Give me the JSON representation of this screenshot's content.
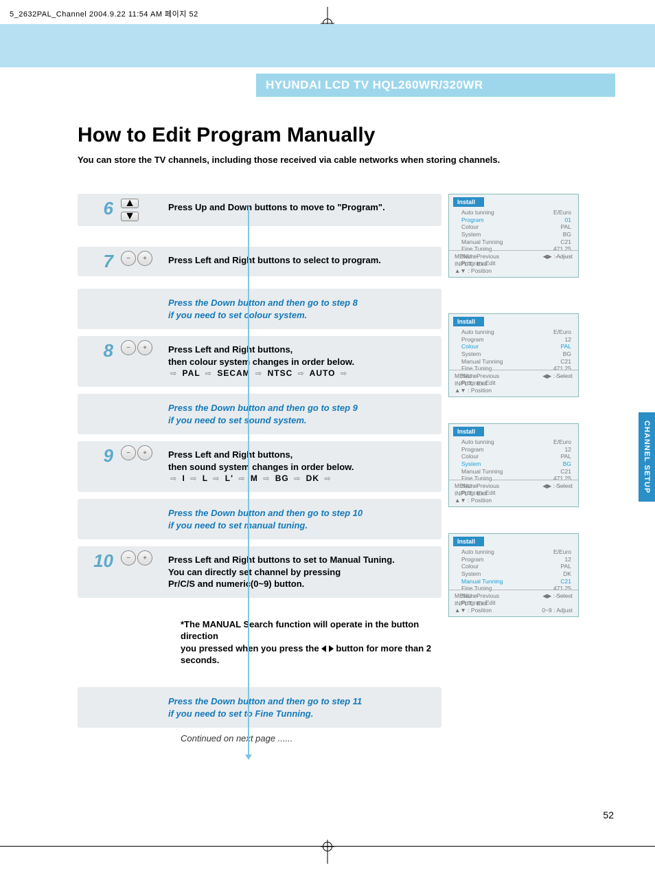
{
  "meta_header": "5_2632PAL_Channel  2004.9.22 11:54 AM  페이지 52",
  "product_header": "HYUNDAI LCD TV HQL260WR/320WR",
  "page_title": "How to Edit Program Manually",
  "page_subtitle": "You can store the TV channels, including those received via cable networks when storing channels.",
  "side_tab": "CHANNEL SETUP",
  "page_number": "52",
  "continued": "Continued on next page ......",
  "steps": {
    "s6": {
      "num": "6",
      "text": "Press Up and Down buttons to move to \"Program\"."
    },
    "s7": {
      "num": "7",
      "text": "Press Left and Right buttons to select to program."
    },
    "hint8": "Press the Down button and then go to step 8\nif you need to set colour system.",
    "s8": {
      "num": "8",
      "text1": "Press Left and Right buttons,",
      "text2": "then colour system changes in order below.",
      "seq": [
        "PAL",
        "SECAM",
        "NTSC",
        "AUTO"
      ]
    },
    "hint9": "Press the Down button and then go to step 9\nif you need to set sound system.",
    "s9": {
      "num": "9",
      "text1": "Press Left and Right buttons,",
      "text2": "then sound system changes in order below.",
      "seq": [
        "I",
        "L",
        "L'",
        "M",
        "BG",
        "DK"
      ]
    },
    "hint10": "Press the Down button and then go to step 10\nif you need to set manual tuning.",
    "s10": {
      "num": "10",
      "text1": "Press Left and Right buttons to set to Manual Tuning.",
      "text2": "You can directly set channel by pressing",
      "text3": "Pr/C/S and numeric(0~9) button."
    },
    "note": "*The MANUAL Search function will operate in the button direction\nyou pressed when you press the  ◀ ▶ button for more than 2 seconds.",
    "hint11": "Press the Down button and then go to step 11\nif you need to set to Fine Tunning."
  },
  "osd_title": "Install",
  "osd_items": [
    "Auto tunning",
    "Program",
    "Colour",
    "System",
    "Manual Tunning",
    "Fine Tuning",
    "Name",
    "Program Edit"
  ],
  "osd_foot_prev": "MENU : Previous",
  "osd_foot_exit": "INPUT : Exit",
  "osd_foot_pos": "▲▼ : Position",
  "osd_foot_adjust": "◀▶ : Adjust",
  "osd_foot_select": "◀▶ : Select",
  "osd_extra_adjust": "0~9 : Adjust",
  "osd_boxes": [
    {
      "highlight_index": 1,
      "values": [
        "E/Euro",
        "01",
        "PAL",
        "BG",
        "C21",
        "471.25",
        "- - - - -",
        ""
      ],
      "foot_right": "adjust",
      "extra": false
    },
    {
      "highlight_index": 2,
      "values": [
        "E/Euro",
        "12",
        "PAL",
        "BG",
        "C21",
        "471.25",
        "- - - - -",
        ""
      ],
      "foot_right": "select",
      "extra": false
    },
    {
      "highlight_index": 3,
      "values": [
        "E/Euro",
        "12",
        "PAL",
        "BG",
        "C21",
        "471.25",
        "- - - - -",
        ""
      ],
      "foot_right": "select",
      "extra": false
    },
    {
      "highlight_index": 4,
      "values": [
        "E/Euro",
        "12",
        "PAL",
        "DK",
        "C21",
        "471.25",
        "- - - - -",
        ""
      ],
      "foot_right": "select",
      "extra": true
    }
  ]
}
